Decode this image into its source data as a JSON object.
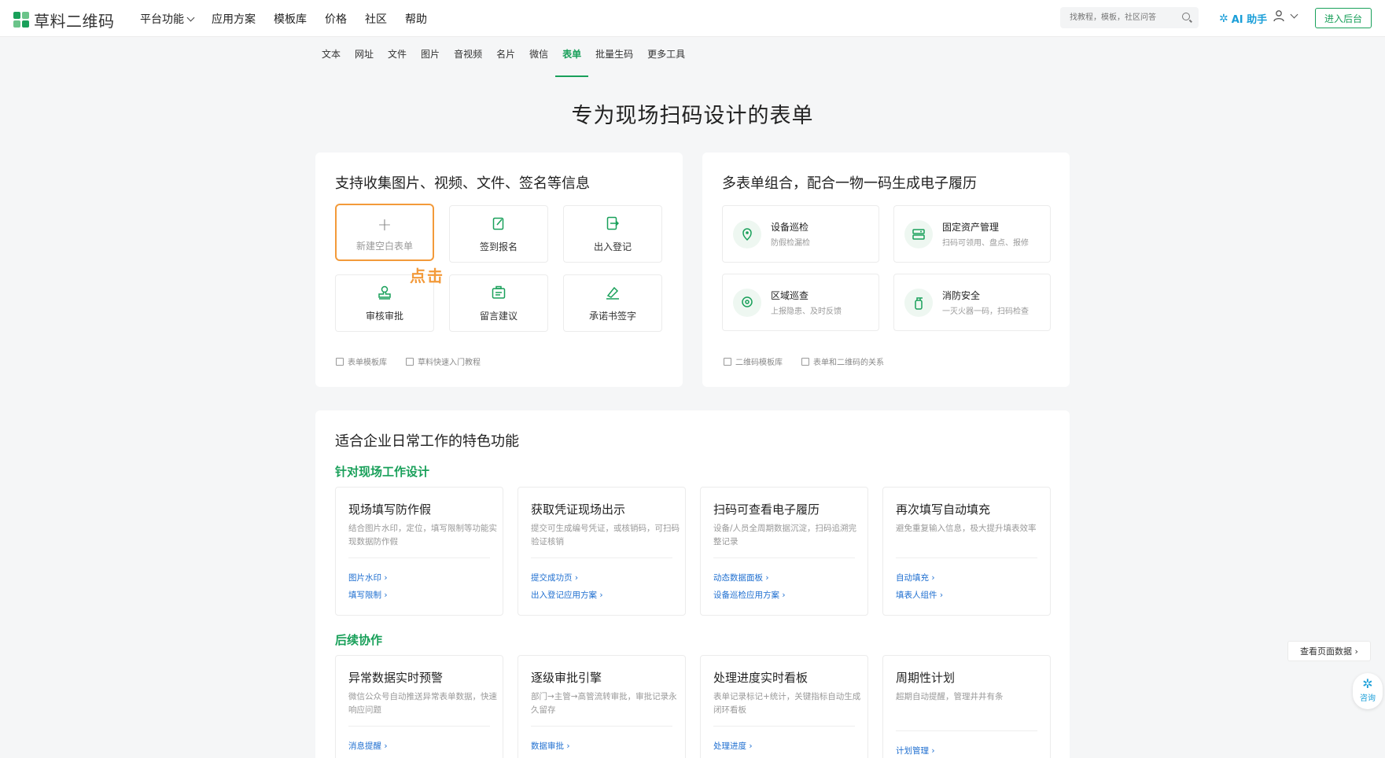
{
  "header": {
    "logo_text": "草料二维码",
    "nav": [
      "平台功能",
      "应用方案",
      "模板库",
      "价格",
      "社区",
      "帮助"
    ],
    "search_placeholder": "找教程，模板，社区问答",
    "ai_label": "AI 助手",
    "enter_label": "进入后台"
  },
  "subnav": {
    "items": [
      "文本",
      "网址",
      "文件",
      "图片",
      "音视频",
      "名片",
      "微信",
      "表单",
      "批量生码",
      "更多工具"
    ],
    "active": "表单"
  },
  "page_title": "专为现场扫码设计的表单",
  "collect_card": {
    "title": "支持收集图片、视频、文件、签名等信息",
    "new_tile_label": "新建空白表单",
    "tiles": [
      "签到报名",
      "出入登记",
      "审核审批",
      "留言建议",
      "承诺书签字"
    ],
    "click_hint": "点击",
    "links": [
      "表单模板库",
      "草料快速入门教程"
    ]
  },
  "combo_card": {
    "title": "多表单组合，配合一物一码生成电子履历",
    "items": [
      {
        "title": "设备巡检",
        "desc": "防假检漏检"
      },
      {
        "title": "固定资产管理",
        "desc": "扫码可领用、盘点、报修"
      },
      {
        "title": "区域巡查",
        "desc": "上报隐患、及时反馈"
      },
      {
        "title": "消防安全",
        "desc": "一灭火器一码，扫码检查"
      }
    ],
    "links": [
      "二维码模板库",
      "表单和二维码的关系"
    ]
  },
  "features": {
    "title": "适合企业日常工作的特色功能",
    "section1": "针对现场工作设计",
    "section2": "后续协作",
    "cards1": [
      {
        "title": "现场填写防作假",
        "desc": "结合图片水印，定位，填写限制等功能实现数据防作假",
        "links": [
          "图片水印 ›",
          "填写限制 ›"
        ]
      },
      {
        "title": "获取凭证现场出示",
        "desc": "提交可生成编号凭证，或核销码，可扫码验证核销",
        "links": [
          "提交成功页 ›",
          "出入登记应用方案 ›"
        ]
      },
      {
        "title": "扫码可查看电子履历",
        "desc": "设备/人员全周期数据沉淀，扫码追溯完整记录",
        "links": [
          "动态数据面板 ›",
          "设备巡检应用方案 ›"
        ]
      },
      {
        "title": "再次填写自动填充",
        "desc": "避免重复输入信息，极大提升填表效率",
        "links": [
          "自动填充 ›",
          "填表人组件 ›"
        ]
      }
    ],
    "cards2": [
      {
        "title": "异常数据实时预警",
        "desc": "微信公众号自动推送异常表单数据，快速响应问题",
        "links": [
          "消息提醒 ›"
        ]
      },
      {
        "title": "逐级审批引擎",
        "desc": "部门→主管→高管流转审批，审批记录永久留存",
        "links": [
          "数据审批 ›"
        ]
      },
      {
        "title": "处理进度实时看板",
        "desc": "表单记录标记+统计，关键指标自动生成闭环看板",
        "links": [
          "处理进度 ›"
        ]
      },
      {
        "title": "周期性计划",
        "desc": "超期自动提醒，管理井井有条",
        "links": [
          "计划管理 ›"
        ]
      }
    ]
  },
  "side": {
    "view_data": "查看页面数据 ›",
    "consult": "咨询"
  },
  "colors": {
    "brand": "#19a05a",
    "accent_orange": "#f39a3a",
    "link_blue": "#1f6fd0",
    "ai_blue": "#1a9ed8"
  }
}
